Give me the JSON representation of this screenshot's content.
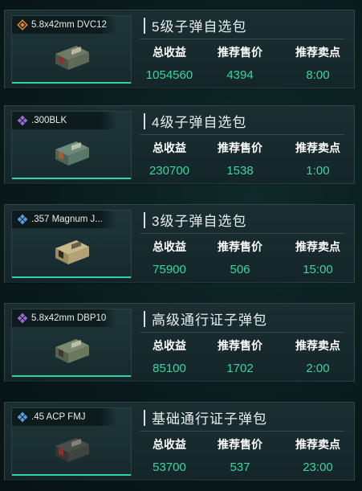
{
  "colors": {
    "accent": "#2fd3a5",
    "value": "#39d6a0",
    "orange": "#e28a3b",
    "purple": "#9b6bd8",
    "blue": "#5aa0e6"
  },
  "columns": {
    "income": "总收益",
    "price": "推荐售价",
    "time": "推荐卖点"
  },
  "cards": [
    {
      "ammo": "5.8x42mm DVC12",
      "rarity_icon": "orange-diamond-icon",
      "title": "5级子弹自选包",
      "income": "1054560",
      "price": "4394",
      "time": "8:00"
    },
    {
      "ammo": ".300BLK",
      "rarity_icon": "purple-diamond-icon",
      "title": "4级子弹自选包",
      "income": "230700",
      "price": "1538",
      "time": "1:00"
    },
    {
      "ammo": ".357 Magnum J...",
      "rarity_icon": "blue-diamond-icon",
      "title": "3级子弹自选包",
      "income": "75900",
      "price": "506",
      "time": "15:00"
    },
    {
      "ammo": "5.8x42mm DBP10",
      "rarity_icon": "purple-diamond-icon",
      "title": "高级通行证子弹包",
      "income": "85100",
      "price": "1702",
      "time": "2:00"
    },
    {
      "ammo": ".45 ACP FMJ",
      "rarity_icon": "blue-diamond-icon",
      "title": "基础通行证子弹包",
      "income": "53700",
      "price": "537",
      "time": "23:00"
    }
  ]
}
